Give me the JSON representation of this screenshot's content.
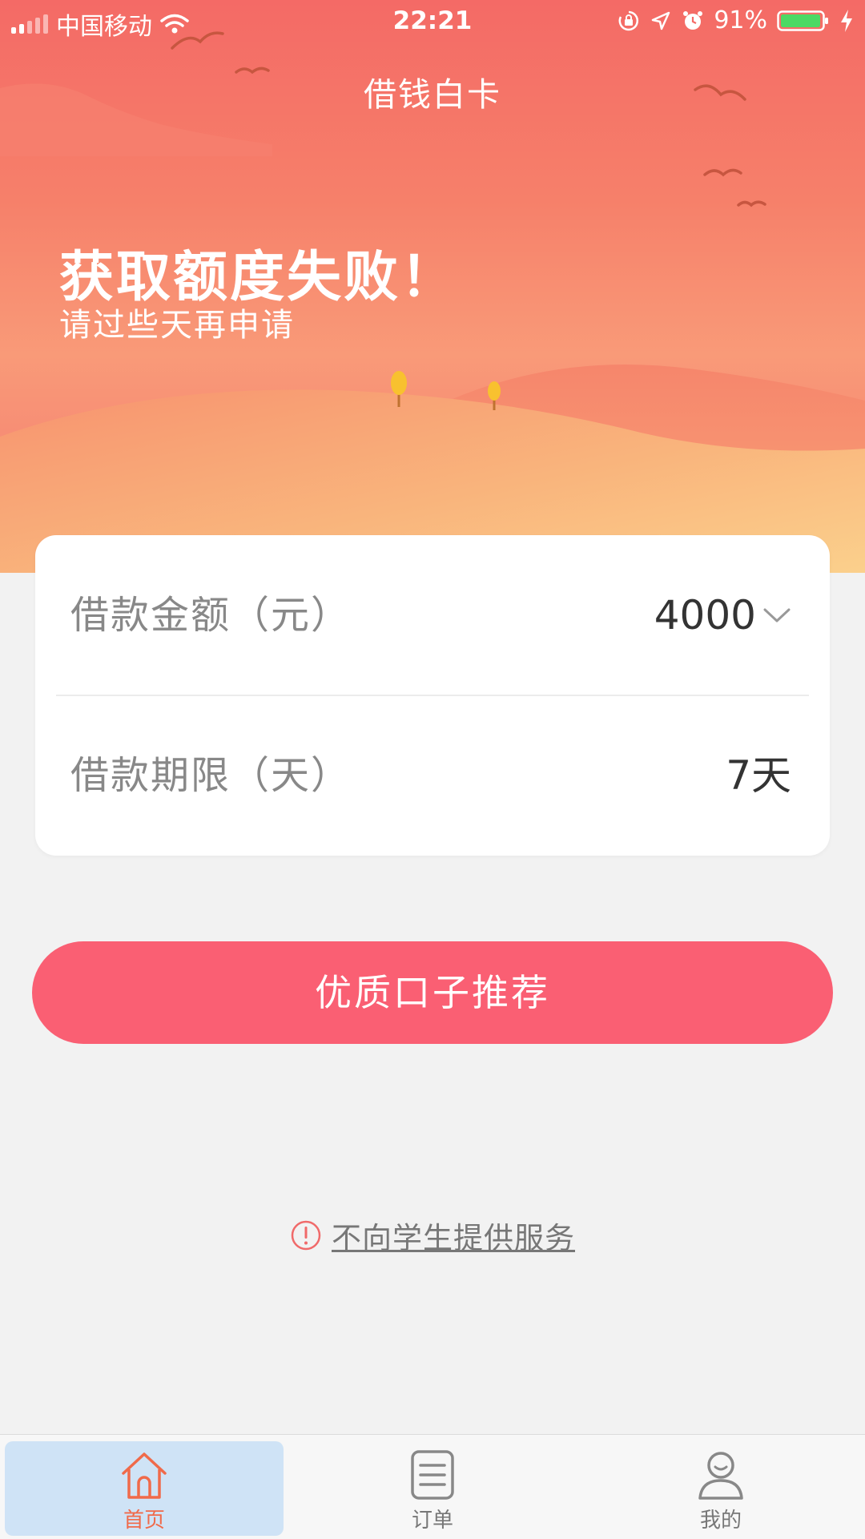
{
  "status_bar": {
    "carrier": "中国移动",
    "time": "22:21",
    "battery": "91%"
  },
  "header": {
    "title": "借钱白卡"
  },
  "hero": {
    "headline": "获取额度失败！",
    "subline": "请过些天再申请"
  },
  "form": {
    "amount": {
      "label": "借款金额（元）",
      "value": "4000"
    },
    "term": {
      "label": "借款期限（天）",
      "value": "7天"
    }
  },
  "cta": {
    "label": "优质口子推荐"
  },
  "notice": {
    "text": "不向学生提供服务"
  },
  "tabbar": {
    "items": [
      {
        "label": "首页",
        "active": true
      },
      {
        "label": "订单",
        "active": false
      },
      {
        "label": "我的",
        "active": false
      }
    ]
  },
  "colors": {
    "accent": "#fa5f73",
    "active_tab": "#f06a4a",
    "hero_top": "#f46a66",
    "hero_sand": "#f9c585"
  }
}
